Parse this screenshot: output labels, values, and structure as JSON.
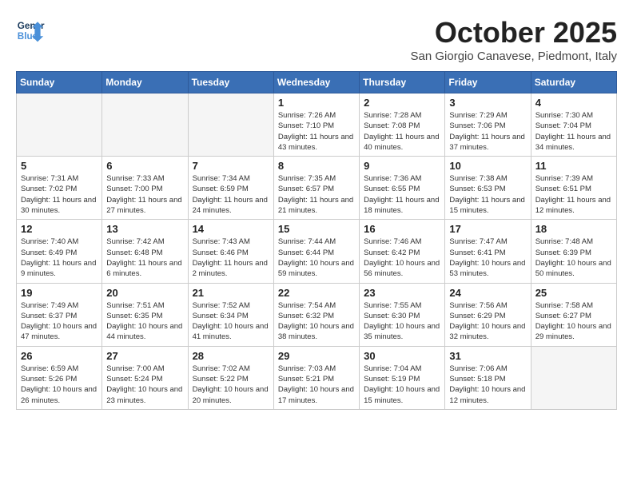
{
  "header": {
    "logo_line1": "General",
    "logo_line2": "Blue",
    "month": "October 2025",
    "location": "San Giorgio Canavese, Piedmont, Italy"
  },
  "weekdays": [
    "Sunday",
    "Monday",
    "Tuesday",
    "Wednesday",
    "Thursday",
    "Friday",
    "Saturday"
  ],
  "weeks": [
    [
      {
        "day": "",
        "info": ""
      },
      {
        "day": "",
        "info": ""
      },
      {
        "day": "",
        "info": ""
      },
      {
        "day": "1",
        "info": "Sunrise: 7:26 AM\nSunset: 7:10 PM\nDaylight: 11 hours and 43 minutes."
      },
      {
        "day": "2",
        "info": "Sunrise: 7:28 AM\nSunset: 7:08 PM\nDaylight: 11 hours and 40 minutes."
      },
      {
        "day": "3",
        "info": "Sunrise: 7:29 AM\nSunset: 7:06 PM\nDaylight: 11 hours and 37 minutes."
      },
      {
        "day": "4",
        "info": "Sunrise: 7:30 AM\nSunset: 7:04 PM\nDaylight: 11 hours and 34 minutes."
      }
    ],
    [
      {
        "day": "5",
        "info": "Sunrise: 7:31 AM\nSunset: 7:02 PM\nDaylight: 11 hours and 30 minutes."
      },
      {
        "day": "6",
        "info": "Sunrise: 7:33 AM\nSunset: 7:00 PM\nDaylight: 11 hours and 27 minutes."
      },
      {
        "day": "7",
        "info": "Sunrise: 7:34 AM\nSunset: 6:59 PM\nDaylight: 11 hours and 24 minutes."
      },
      {
        "day": "8",
        "info": "Sunrise: 7:35 AM\nSunset: 6:57 PM\nDaylight: 11 hours and 21 minutes."
      },
      {
        "day": "9",
        "info": "Sunrise: 7:36 AM\nSunset: 6:55 PM\nDaylight: 11 hours and 18 minutes."
      },
      {
        "day": "10",
        "info": "Sunrise: 7:38 AM\nSunset: 6:53 PM\nDaylight: 11 hours and 15 minutes."
      },
      {
        "day": "11",
        "info": "Sunrise: 7:39 AM\nSunset: 6:51 PM\nDaylight: 11 hours and 12 minutes."
      }
    ],
    [
      {
        "day": "12",
        "info": "Sunrise: 7:40 AM\nSunset: 6:49 PM\nDaylight: 11 hours and 9 minutes."
      },
      {
        "day": "13",
        "info": "Sunrise: 7:42 AM\nSunset: 6:48 PM\nDaylight: 11 hours and 6 minutes."
      },
      {
        "day": "14",
        "info": "Sunrise: 7:43 AM\nSunset: 6:46 PM\nDaylight: 11 hours and 2 minutes."
      },
      {
        "day": "15",
        "info": "Sunrise: 7:44 AM\nSunset: 6:44 PM\nDaylight: 10 hours and 59 minutes."
      },
      {
        "day": "16",
        "info": "Sunrise: 7:46 AM\nSunset: 6:42 PM\nDaylight: 10 hours and 56 minutes."
      },
      {
        "day": "17",
        "info": "Sunrise: 7:47 AM\nSunset: 6:41 PM\nDaylight: 10 hours and 53 minutes."
      },
      {
        "day": "18",
        "info": "Sunrise: 7:48 AM\nSunset: 6:39 PM\nDaylight: 10 hours and 50 minutes."
      }
    ],
    [
      {
        "day": "19",
        "info": "Sunrise: 7:49 AM\nSunset: 6:37 PM\nDaylight: 10 hours and 47 minutes."
      },
      {
        "day": "20",
        "info": "Sunrise: 7:51 AM\nSunset: 6:35 PM\nDaylight: 10 hours and 44 minutes."
      },
      {
        "day": "21",
        "info": "Sunrise: 7:52 AM\nSunset: 6:34 PM\nDaylight: 10 hours and 41 minutes."
      },
      {
        "day": "22",
        "info": "Sunrise: 7:54 AM\nSunset: 6:32 PM\nDaylight: 10 hours and 38 minutes."
      },
      {
        "day": "23",
        "info": "Sunrise: 7:55 AM\nSunset: 6:30 PM\nDaylight: 10 hours and 35 minutes."
      },
      {
        "day": "24",
        "info": "Sunrise: 7:56 AM\nSunset: 6:29 PM\nDaylight: 10 hours and 32 minutes."
      },
      {
        "day": "25",
        "info": "Sunrise: 7:58 AM\nSunset: 6:27 PM\nDaylight: 10 hours and 29 minutes."
      }
    ],
    [
      {
        "day": "26",
        "info": "Sunrise: 6:59 AM\nSunset: 5:26 PM\nDaylight: 10 hours and 26 minutes."
      },
      {
        "day": "27",
        "info": "Sunrise: 7:00 AM\nSunset: 5:24 PM\nDaylight: 10 hours and 23 minutes."
      },
      {
        "day": "28",
        "info": "Sunrise: 7:02 AM\nSunset: 5:22 PM\nDaylight: 10 hours and 20 minutes."
      },
      {
        "day": "29",
        "info": "Sunrise: 7:03 AM\nSunset: 5:21 PM\nDaylight: 10 hours and 17 minutes."
      },
      {
        "day": "30",
        "info": "Sunrise: 7:04 AM\nSunset: 5:19 PM\nDaylight: 10 hours and 15 minutes."
      },
      {
        "day": "31",
        "info": "Sunrise: 7:06 AM\nSunset: 5:18 PM\nDaylight: 10 hours and 12 minutes."
      },
      {
        "day": "",
        "info": ""
      }
    ]
  ]
}
